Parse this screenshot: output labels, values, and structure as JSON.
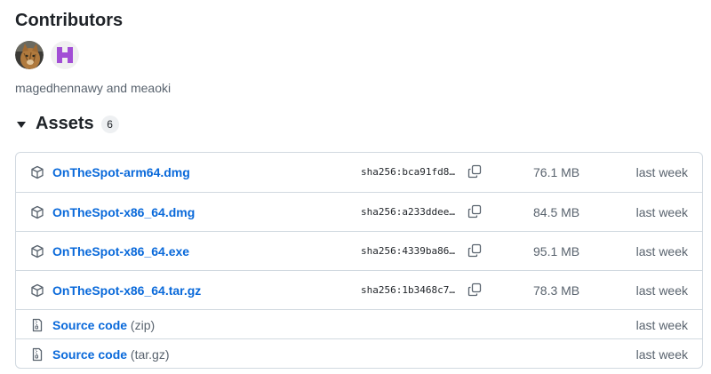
{
  "contributors": {
    "title": "Contributors",
    "avatars": [
      {
        "user": "magedhennawy",
        "icon": "cat-photo-avatar"
      },
      {
        "user": "meaoki",
        "icon": "purple-identicon-avatar"
      }
    ],
    "names_text": "magedhennawy and meaoki"
  },
  "assets": {
    "title": "Assets",
    "count": "6",
    "files": [
      {
        "name": "OnTheSpot-arm64.dmg",
        "sha": "sha256:bca91fd8…",
        "size": "76.1 MB",
        "date": "last week"
      },
      {
        "name": "OnTheSpot-x86_64.dmg",
        "sha": "sha256:a233ddee…",
        "size": "84.5 MB",
        "date": "last week"
      },
      {
        "name": "OnTheSpot-x86_64.exe",
        "sha": "sha256:4339ba86…",
        "size": "95.1 MB",
        "date": "last week"
      },
      {
        "name": "OnTheSpot-x86_64.tar.gz",
        "sha": "sha256:1b3468c7…",
        "size": "78.3 MB",
        "date": "last week"
      }
    ],
    "source": [
      {
        "label": "Source code",
        "ext": "(zip)",
        "date": "last week"
      },
      {
        "label": "Source code",
        "ext": "(tar.gz)",
        "date": "last week"
      }
    ]
  },
  "colors": {
    "link": "#0969da",
    "muted": "#59636e",
    "border": "#d1d9e0",
    "badge_bg": "#eef0f2"
  }
}
